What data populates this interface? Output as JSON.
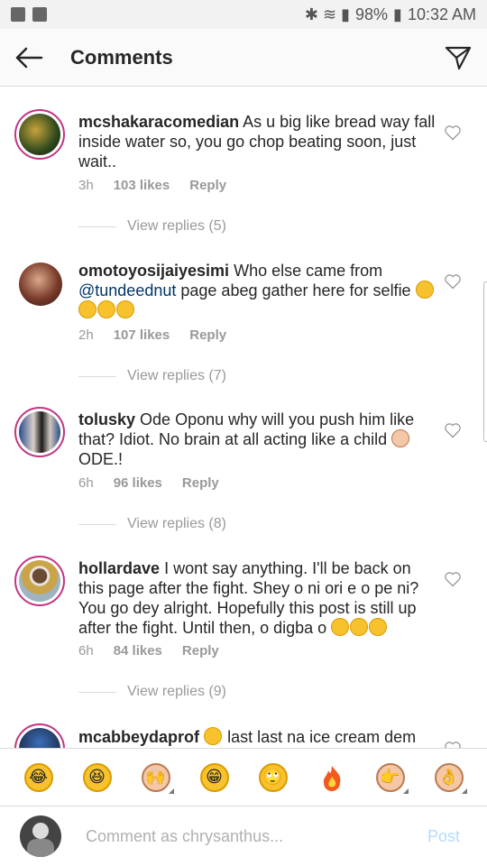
{
  "status_bar": {
    "battery": "98%",
    "time": "10:32 AM"
  },
  "header": {
    "title": "Comments"
  },
  "comments": [
    {
      "username": "mcshakaracomedian",
      "text": "As u big like bread way fall inside water so, you go chop beating soon, just wait..",
      "time": "3h",
      "likes": "103 likes",
      "reply": "Reply",
      "view_replies": "View replies (5)"
    },
    {
      "username": "omotoyosijaiyesimi",
      "text_before": "Who else came from",
      "mention": "@tundeednut",
      "text_after": "page abeg gather here for selfie",
      "time": "2h",
      "likes": "107 likes",
      "reply": "Reply",
      "view_replies": "View replies (7)"
    },
    {
      "username": "tolusky",
      "text": "Ode Oponu why will you push him like that? Idiot. No brain at all acting like a child",
      "text_end": "ODE.!",
      "time": "6h",
      "likes": "96 likes",
      "reply": "Reply",
      "view_replies": "View replies (8)"
    },
    {
      "username": "hollardave",
      "text": "I wont say anything. I'll be back on this page after the fight. Shey o ni ori e o pe ni? You go dey alright. Hopefully this post is still up after the fight. Until then, o digba o",
      "time": "6h",
      "likes": "84 likes",
      "reply": "Reply",
      "view_replies": "View replies (9)"
    },
    {
      "username": "mcabbeydaprof",
      "text": "last last na ice cream dem"
    }
  ],
  "emoji_bar": [
    "rofl",
    "joy",
    "person-raising-hand",
    "grin",
    "rolling-eyes",
    "fire",
    "pointing-hand",
    "ok-hand"
  ],
  "composer": {
    "placeholder": "Comment as chrysanthus...",
    "post_label": "Post"
  },
  "colors": {
    "mention": "#003569",
    "post": "#b3dbff",
    "ring": "#c13584"
  }
}
